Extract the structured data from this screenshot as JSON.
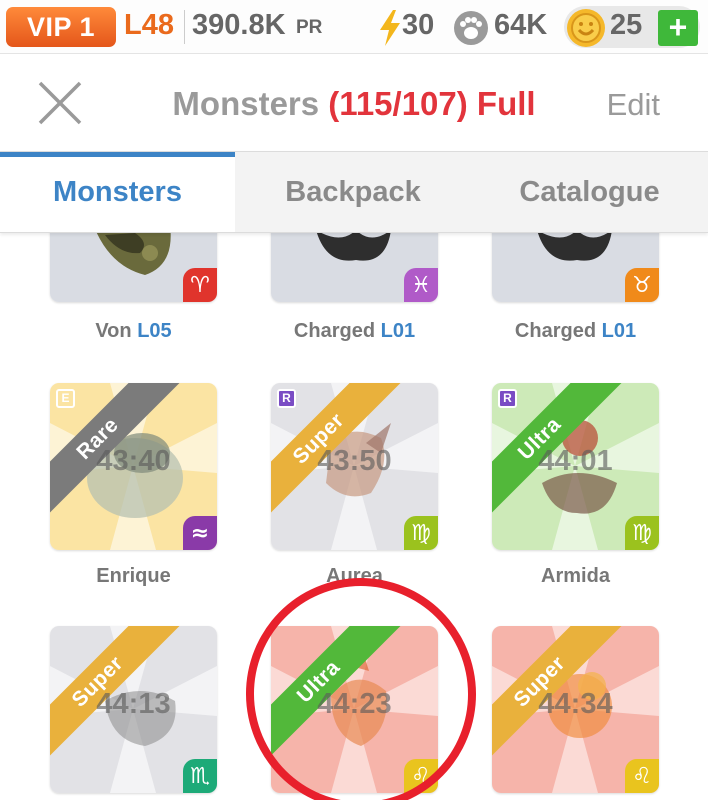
{
  "status": {
    "vip": "VIP 1",
    "level": "L48",
    "pr_value": "390.8K",
    "pr_label": "PR",
    "energy": "30",
    "paws": "64K",
    "coins": "25",
    "add_label": "+"
  },
  "header": {
    "title": "Monsters",
    "count": "(115/107) Full",
    "edit_label": "Edit"
  },
  "tabs": [
    {
      "label": "Monsters",
      "active": true
    },
    {
      "label": "Backpack",
      "active": false
    },
    {
      "label": "Catalogue",
      "active": false
    }
  ],
  "monsters": [
    {
      "name": "Von",
      "level": "L05",
      "zodiac": "♈",
      "zodiac_color": "#e0342c",
      "bg": "#d9dce3"
    },
    {
      "name": "Charged",
      "level": "L01",
      "zodiac": "♓",
      "zodiac_color": "#b05ac8",
      "bg": "#d9dce3"
    },
    {
      "name": "Charged",
      "level": "L01",
      "zodiac": "♉",
      "zodiac_color": "#f08a1a",
      "bg": "#d9dce3"
    },
    {
      "name": "Enrique",
      "timer": "43:40",
      "rarity": "Rare",
      "rarity_color": "#7b7b7b",
      "badge": "E",
      "zodiac": "≈",
      "zodiac_color": "#8a3aa8",
      "bg": "#fbe4a3"
    },
    {
      "name": "Aurea",
      "timer": "43:50",
      "rarity": "Super",
      "rarity_color": "#e9b13c",
      "badge": "R",
      "zodiac": "♍",
      "zodiac_color": "#9bc21e",
      "bg": "#e2e2e6"
    },
    {
      "name": "Armida",
      "timer": "44:01",
      "rarity": "Ultra",
      "rarity_color": "#52b83a",
      "badge": "R",
      "zodiac": "♍",
      "zodiac_color": "#9bc21e",
      "bg": "#cdeab8"
    },
    {
      "name": "",
      "timer": "44:13",
      "rarity": "Super",
      "rarity_color": "#e9b13c",
      "zodiac": "♏",
      "zodiac_color": "#1daa78",
      "bg": "#e2e2e6"
    },
    {
      "name": "",
      "timer": "44:23",
      "rarity": "Ultra",
      "rarity_color": "#52b83a",
      "zodiac": "♌",
      "zodiac_color": "#e9c41e",
      "bg": "#f6b4aa"
    },
    {
      "name": "",
      "timer": "44:34",
      "rarity": "Super",
      "rarity_color": "#e9b13c",
      "zodiac": "♌",
      "zodiac_color": "#e9c41e",
      "bg": "#f6b4aa"
    }
  ]
}
